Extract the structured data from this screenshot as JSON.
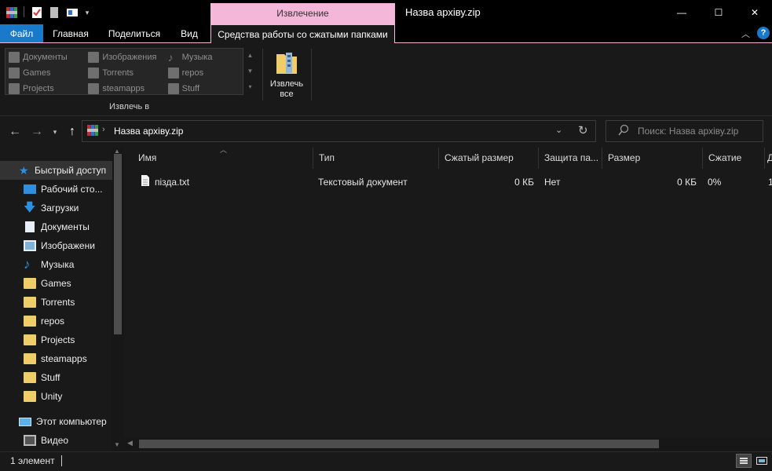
{
  "window": {
    "title": "Назва архіву.zip",
    "context_tab": "Извлечение",
    "minimize": "—",
    "maximize": "☐",
    "close": "✕"
  },
  "colors": {
    "accent": "#1979ca",
    "context_pink": "#f4b6d9",
    "folder": "#f0cd6b",
    "background": "#191919"
  },
  "ribbon": {
    "tabs": {
      "file": "Файл",
      "home": "Главная",
      "share": "Поделиться",
      "view": "Вид",
      "tools": "Средства работы со сжатыми папками"
    },
    "gallery": [
      [
        "Документы",
        "Изображения",
        "Музыка"
      ],
      [
        "Games",
        "Torrents",
        "repos"
      ],
      [
        "Projects",
        "steamapps",
        "Stuff"
      ]
    ],
    "group_label": "Извлечь в",
    "extract_all": [
      "Извлечь",
      "все"
    ],
    "collapse_icon": "chevron-up-icon",
    "help_icon": "?"
  },
  "address": {
    "path": "Назва архіву.zip",
    "search_placeholder": "Поиск: Назва архіву.zip"
  },
  "nav": {
    "quick_access": "Быстрый доступ",
    "items": [
      "Рабочий сто...",
      "Загрузки",
      "Документы",
      "Изображени",
      "Музыка",
      "Games",
      "Torrents",
      "repos",
      "Projects",
      "steamapps",
      "Stuff",
      "Unity"
    ],
    "this_pc": "Этот компьютер",
    "video": "Видео"
  },
  "table": {
    "columns": [
      "Имя",
      "Тип",
      "Сжатый размер",
      "Защита па...",
      "Размер",
      "Сжатие",
      "Д"
    ],
    "rows": [
      {
        "name": "пізда.txt",
        "type": "Текстовый документ",
        "packed": "0 КБ",
        "protected": "Нет",
        "size": "0 КБ",
        "ratio": "0%",
        "extra": "1"
      }
    ]
  },
  "status": {
    "count": "1 элемент"
  }
}
